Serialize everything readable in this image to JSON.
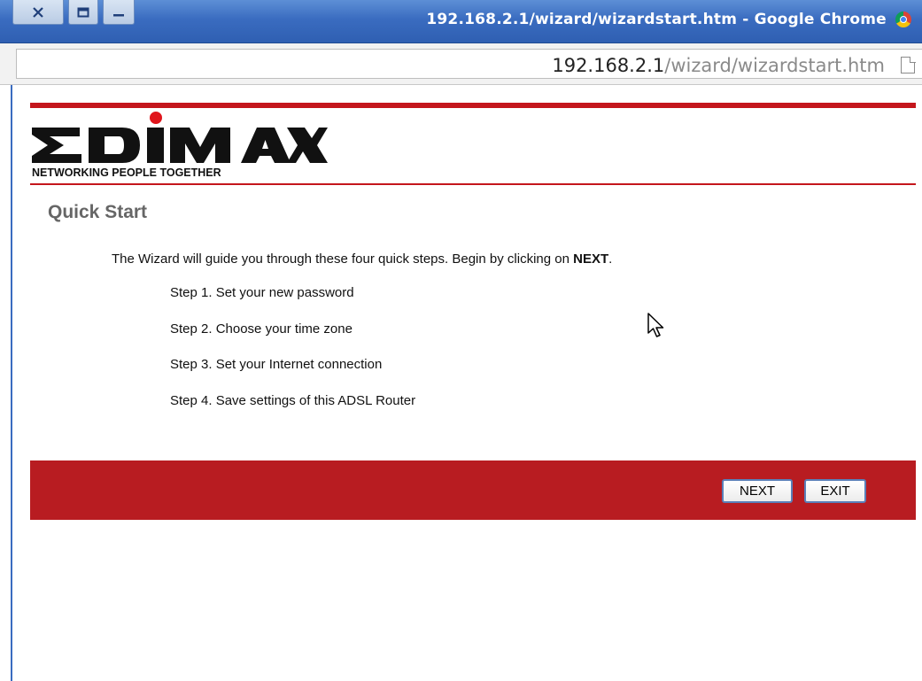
{
  "window": {
    "title": "192.168.2.1/wizard/wizardstart.htm - Google Chrome",
    "controls": [
      "close-icon",
      "maximize-icon",
      "minimize-icon"
    ]
  },
  "address_bar": {
    "host": "192.168.2.1",
    "path": "/wizard/wizardstart.htm"
  },
  "logo": {
    "brand": "EDIMAX",
    "tagline": "NETWORKING PEOPLE TOGETHER"
  },
  "page": {
    "title": "Quick Start",
    "intro_prefix": "The Wizard will guide you through these four quick steps. Begin by clicking on ",
    "intro_bold": "NEXT",
    "intro_suffix": ".",
    "steps": [
      "Step 1. Set your new password",
      "Step 2. Choose your time zone",
      "Step 3. Set your Internet connection",
      "Step 4. Save settings of this ADSL Router"
    ]
  },
  "actions": {
    "next_label": "NEXT",
    "exit_label": "EXIT"
  },
  "colors": {
    "brand_red": "#c4161c",
    "bar_red": "#b81c21",
    "titlebar_blue": "#3a6cc0"
  }
}
